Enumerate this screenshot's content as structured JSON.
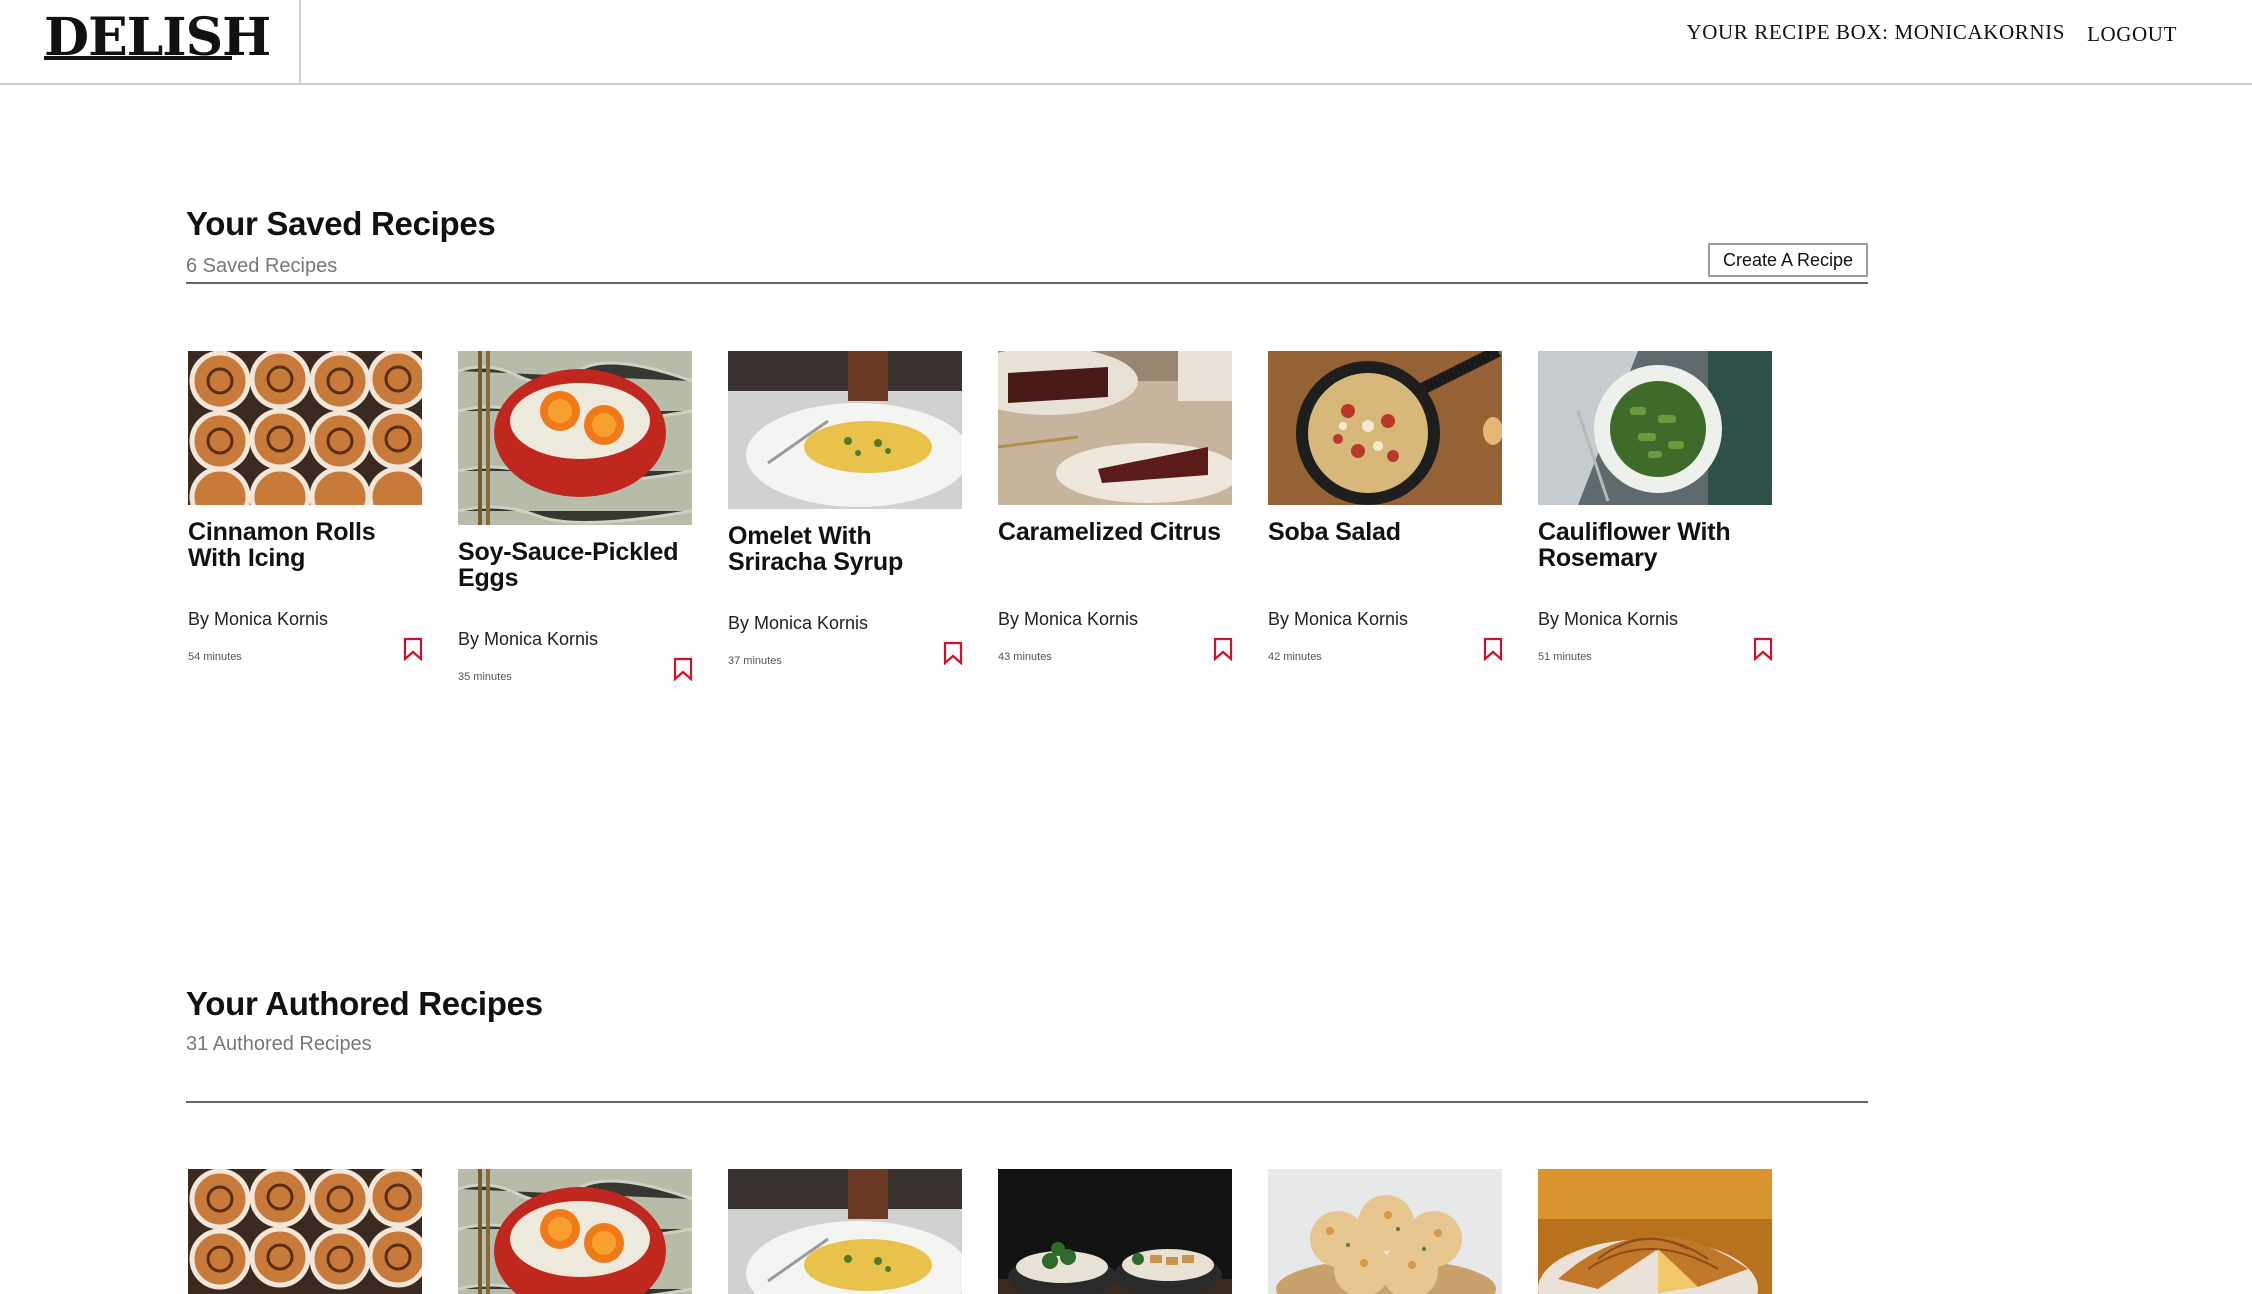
{
  "header": {
    "logo": "DELISH",
    "recipe_box": "YOUR RECIPE BOX: MONICAKORNIS",
    "logout": "LOGOUT"
  },
  "saved": {
    "title": "Your Saved Recipes",
    "count": "6 Saved Recipes",
    "create_button": "Create A Recipe",
    "recipes": [
      {
        "title": "Cinnamon Rolls With Icing",
        "author": "By Monica Kornis",
        "time": "54 minutes",
        "image": "cinnamon-rolls"
      },
      {
        "title": "Soy-Sauce-Pickled Eggs",
        "author": "By Monica Kornis",
        "time": "35 minutes",
        "image": "pickled-eggs"
      },
      {
        "title": "Omelet With Sriracha Syrup",
        "author": "By Monica Kornis",
        "time": "37 minutes",
        "image": "omelet"
      },
      {
        "title": "Caramelized Citrus",
        "author": "By Monica Kornis",
        "time": "43 minutes",
        "image": "chocolate-cake"
      },
      {
        "title": "Soba Salad",
        "author": "By Monica Kornis",
        "time": "42 minutes",
        "image": "skillet-pizza"
      },
      {
        "title": "Cauliflower With Rosemary",
        "author": "By Monica Kornis",
        "time": "51 minutes",
        "image": "pasta-bowl"
      }
    ]
  },
  "authored": {
    "title": "Your Authored Recipes",
    "count": "31 Authored Recipes",
    "recipes": [
      {
        "image": "cinnamon-rolls"
      },
      {
        "image": "pickled-eggs"
      },
      {
        "image": "omelet"
      },
      {
        "image": "rice-bowls"
      },
      {
        "image": "biscuits"
      },
      {
        "image": "galette"
      }
    ]
  },
  "colors": {
    "bookmark": "#d0112b",
    "muted_text": "#777777",
    "rule": "#666666"
  }
}
